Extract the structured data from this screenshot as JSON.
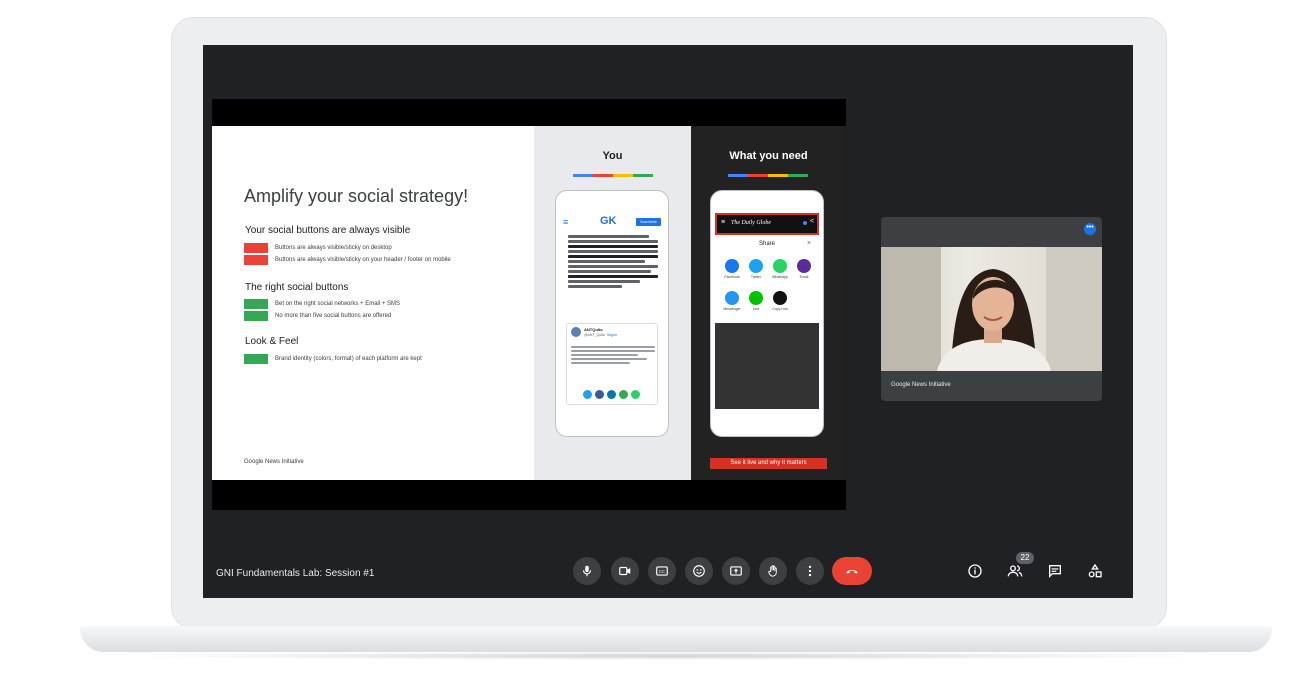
{
  "meeting": {
    "name": "GNI Fundamentals Lab: Session #1"
  },
  "slide": {
    "title": "Amplify your social strategy!",
    "sections": [
      {
        "heading": "Your social buttons are always visible",
        "items": [
          {
            "text": "Buttons are always visible/sticky on desktop",
            "color": "#ea4335"
          },
          {
            "text": "Buttons are always visible/sticky on your header / footer on mobile",
            "color": "#ea4335"
          }
        ]
      },
      {
        "heading": "The right social buttons",
        "items": [
          {
            "text": "Bet on the right social networks + Email + SMS",
            "color": "#34a853"
          },
          {
            "text": "No more than five social buttons are offered",
            "color": "#34a853"
          }
        ]
      },
      {
        "heading": "Look & Feel",
        "items": [
          {
            "text": "Brand identity (colors, format) of each platform are kept",
            "color": "#34a853"
          }
        ]
      }
    ],
    "footer_brand": "Google News Initiative",
    "you_label": "You",
    "need_label": "What you need",
    "gk_logo": "GK",
    "subscribe_button": "Suscríbete",
    "globe_masthead": "The Daily Globe",
    "share_title": "Share",
    "share_close": "×",
    "share_targets": [
      {
        "label": "Facebook",
        "color": "#1877f2"
      },
      {
        "label": "Twitter",
        "color": "#1da1f2"
      },
      {
        "label": "Whatsapp",
        "color": "#25d366"
      },
      {
        "label": "Email",
        "color": "#5b2c9e"
      },
      {
        "label": "Messenger",
        "color": "#2196f3"
      },
      {
        "label": "Line",
        "color": "#00c300"
      },
      {
        "label": "Copy Link",
        "color": "#111111"
      }
    ],
    "cta": "See it live and why it matters",
    "tweet_name": "ANTQuito",
    "tweet_handle": "@ANT_Quito",
    "tweet_follow": "Seguir"
  },
  "self_view": {
    "name": "Google News Initiative"
  },
  "controls": {
    "people_count": "22"
  },
  "icons": [
    "mic-icon",
    "camera-icon",
    "captions-icon",
    "emoji-icon",
    "present-icon",
    "raise-hand-icon",
    "more-icon",
    "end-call-icon",
    "info-icon",
    "people-icon",
    "chat-icon",
    "activities-icon"
  ]
}
